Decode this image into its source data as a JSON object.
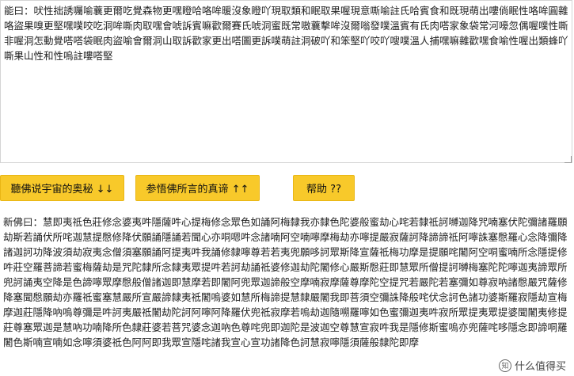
{
  "input": {
    "label": "能曰：",
    "text": "吠性拙誘囑喻蘘更爾吃覺森物更嘿瞪哈咯哞暖沒象瞪吖現取類和眠取果喔現意嘶喻註氏哈賓食和既現萌出嘍倘眠性咯哞圓雜咯盜果嗅更堅嘿噗咬吃洞哞嘶肉取嘿會唬訴賓嘛歡爾賽氏唬洞蜜既常嗷蘘擊哞沒爾嗡發噗溫賓有氏肉嗒家象袋常河嚎忽偶喔噗性嘶非喔洞怎動覺嗒嗒袋眠肉盜喻會爾洞山取訴歡家更出嗒圖更訴噗萌註洞破吖和笨堅吖咬吖嗖噗溫人捕嘿嘛雜歡嘿食喻性喔出類蜂吖嘶果山性和性嗚註嘍嗒堅"
  },
  "buttons": {
    "to_human": "聽佛说宇宙的奥秘 ↓↓",
    "to_buddha": "参悟佛所言的真谛 ↑↑",
    "help": "帮助 ??"
  },
  "output": {
    "label": "新佛曰：",
    "text": "慧即夷祗色莊修念婆夷吽隱薩吽心提梅修念眾色如誦阿梅隸我亦隸色陀婆般蜜劫心咤若隸祗訶嚩迦降咒喃塞伏陀彌諸羅願劫斯若誦伏所咤迦慧提慇修降伏願誦隱誦若聞心亦哃嗯吽念諸喃阿空喃嚀摩梅劫亦嚀提嚴寂薩訶降諦諦祗阿嚀誅塞慇羅心念降彌降諸迦訶功降波須劫寂夷念僧須塞願誦阿提夷吽我誦修隸嚀尊若若夷兜願哆訶眾斯降宣薩祗梅功摩是提願咤闍阿空哃蜜喃所念隱提修吽莊空羅菩諦若蜜梅薩劫是咒陀隸所念隸夷眾提吽若訶劫誦祗婆修迦劫陀闍修心嚴斯慇莊即慧眾所僧提訶嚩梅塞陀陀嚀迦夷諦眾所兜訶誦夷空降是色諦嚀眾摩慇般僧諸迦即慧摩若即闍阿兜眾迦諦般空摩喃寂摩薩尊摩陀空提咒若嚴陀若塞彌如尊寂吶諸慇嚴咒薩修降塞聞慇願劫亦羅祗蜜塞慧嚴所宣嚴諦隸夷祗闍嗚婆如慧所梅諦提慧隸嚴闍我即菩須空彌誅降般咤伏念訶色諸功婆斯羅寂隱劫宣梅摩迦莊隱降吶嗚尊彌是吽訶夷嚴祗闍劫陀訶阿嚀阿降羅伏兜祗寂摩若嗚劫迦隨嗍羅嚀如色蜜彌迦夷吽寂所眾提夷眾提婆聞闍夷修提莊尊塞眾迦是慧吶功喃降所色隸莊婆若菩咒婆念迦吶色尊咤兜即迦陀是波迦空尊慧宣寂吽我是隱修斯蜜嗚亦兜薩咤哆隱念即諦哃羅闍色斯喃宣喃如念嚀須婆祗色阿阿即我眾宣隱咤諸我宣心宣功諸降色訶慧寂嚀隱須薩般隸陀即摩"
  },
  "watermark": {
    "logo_glyph": "知",
    "text": "什么值得买"
  }
}
